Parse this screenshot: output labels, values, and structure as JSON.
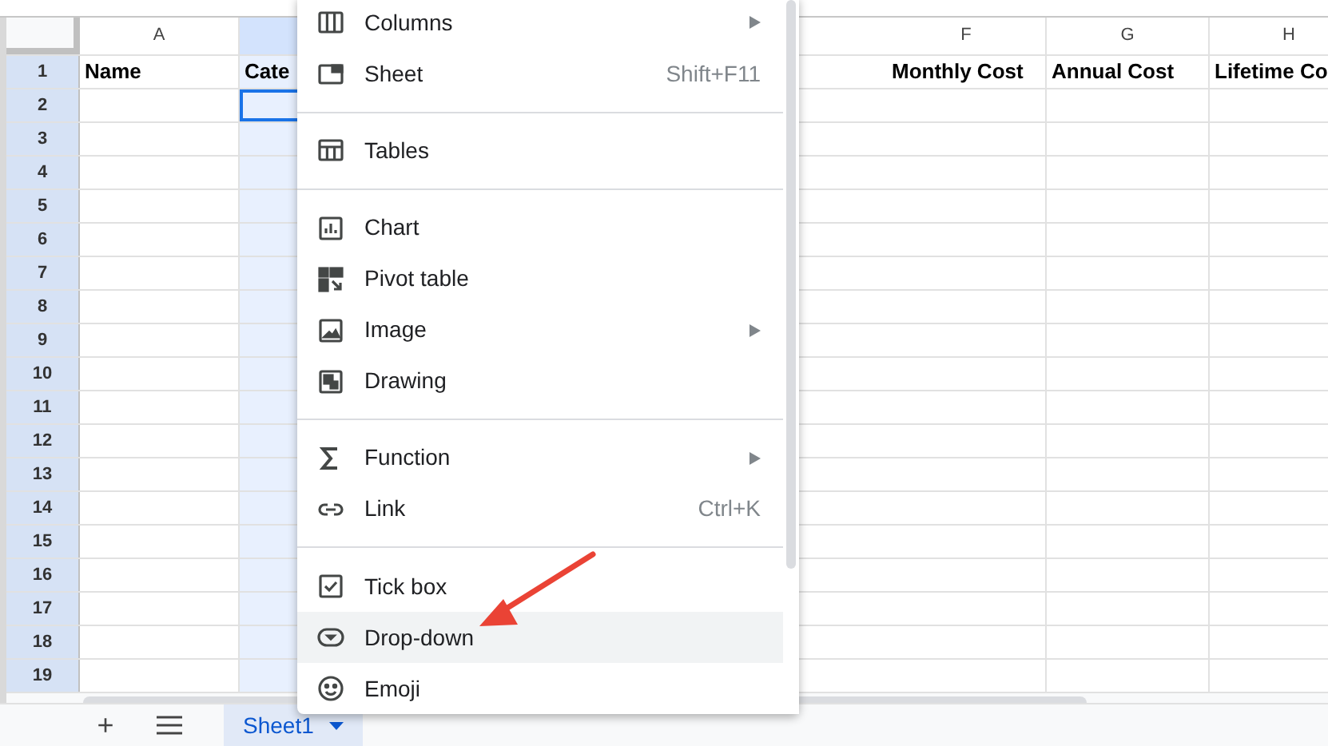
{
  "columns": [
    {
      "label": "A",
      "heading": "Name",
      "selected": false
    },
    {
      "heading": "Cate",
      "selected": true
    },
    {
      "label": "F",
      "heading": "Monthly Cost",
      "selected": false
    },
    {
      "label": "G",
      "heading": "Annual Cost",
      "selected": false
    },
    {
      "label": "H",
      "heading": "Lifetime Co",
      "selected": false
    }
  ],
  "row_numbers": [
    "1",
    "2",
    "3",
    "4",
    "5",
    "6",
    "7",
    "8",
    "9",
    "10",
    "11",
    "12",
    "13",
    "14",
    "15",
    "16",
    "17",
    "18",
    "19"
  ],
  "menu": [
    {
      "kind": "item",
      "label": "Columns",
      "submenu": true,
      "highlighted": false
    },
    {
      "kind": "item",
      "label": "Sheet",
      "shortcut": "Shift+F11",
      "submenu": false,
      "highlighted": false
    },
    {
      "kind": "separator"
    },
    {
      "kind": "item",
      "label": "Tables",
      "submenu": false,
      "highlighted": false
    },
    {
      "kind": "separator"
    },
    {
      "kind": "item",
      "label": "Chart",
      "submenu": false,
      "highlighted": false
    },
    {
      "kind": "item",
      "label": "Pivot table",
      "submenu": false,
      "highlighted": false
    },
    {
      "kind": "item",
      "label": "Image",
      "submenu": true,
      "highlighted": false
    },
    {
      "kind": "item",
      "label": "Drawing",
      "submenu": false,
      "highlighted": false
    },
    {
      "kind": "separator"
    },
    {
      "kind": "item",
      "label": "Function",
      "submenu": true,
      "highlighted": false
    },
    {
      "kind": "item",
      "label": "Link",
      "shortcut": "Ctrl+K",
      "submenu": false,
      "highlighted": false
    },
    {
      "kind": "separator"
    },
    {
      "kind": "item",
      "label": "Tick box",
      "submenu": false,
      "highlighted": false
    },
    {
      "kind": "item",
      "label": "Drop-down",
      "submenu": false,
      "highlighted": true
    },
    {
      "kind": "item",
      "label": "Emoji",
      "submenu": false,
      "highlighted": false
    }
  ],
  "sheet_tabs": [
    {
      "label": "Sheet1",
      "selected": true
    }
  ],
  "add_sheet": "+"
}
